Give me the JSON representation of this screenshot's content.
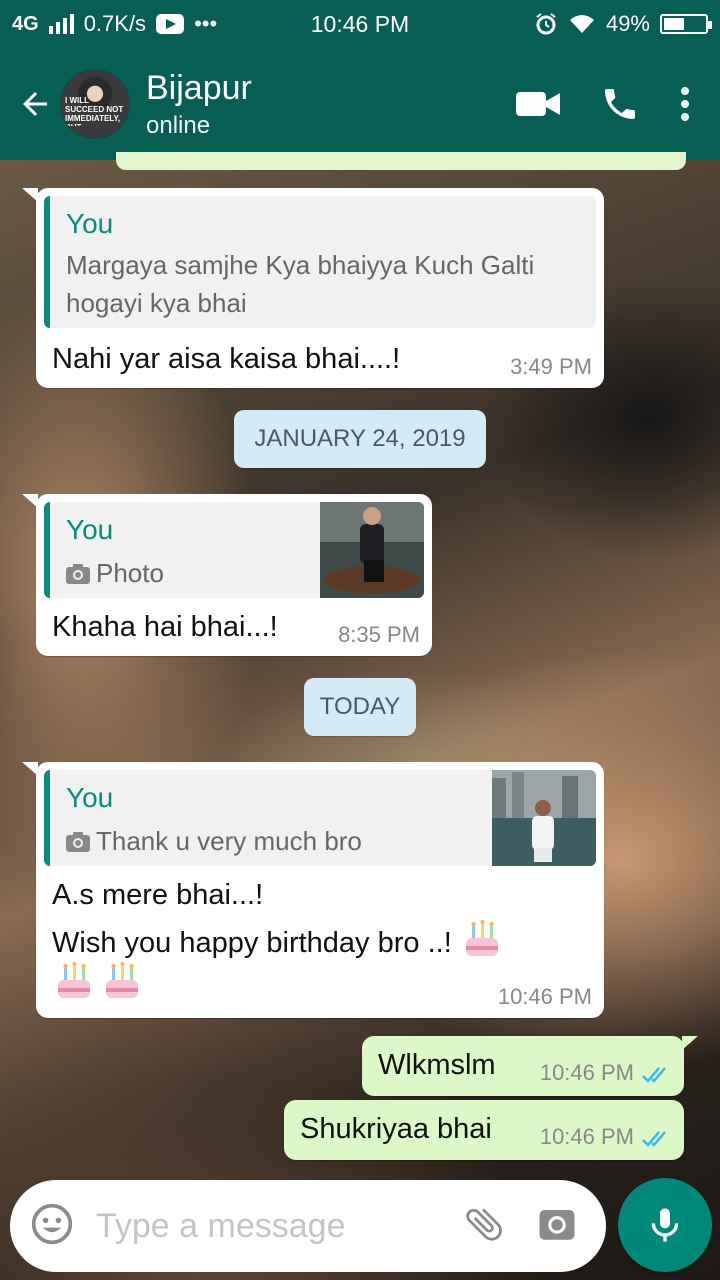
{
  "status_bar": {
    "network": "4G",
    "speed": "0.7K/s",
    "more": "•••",
    "time": "10:46 PM",
    "battery": "49%",
    "battery_level": 0.49
  },
  "header": {
    "contact_name": "Bijapur",
    "contact_status": "online",
    "avatar_text": "I WILL SUCCEED NOT IMMEDIATELY, BUT DEFINITELY"
  },
  "messages": [
    {
      "type": "incoming",
      "quote_author": "You",
      "quote_text_line1": "Margaya samjhe Kya bhaiyya Kuch Galti",
      "quote_text_line2": "hogayi kya bhai",
      "text": "Nahi yar aisa kaisa bhai....!",
      "time": "3:49 PM"
    },
    {
      "type": "date",
      "label": "JANUARY 24, 2019"
    },
    {
      "type": "incoming",
      "quote_author": "You",
      "quote_text": "Photo",
      "text": "Khaha hai bhai...!",
      "time": "8:35 PM"
    },
    {
      "type": "date",
      "label": "TODAY"
    },
    {
      "type": "incoming",
      "quote_author": "You",
      "quote_text": "Thank u very much bro",
      "line1": "A.s mere bhai...!",
      "line2": "Wish you happy birthday bro ..!",
      "time": "10:46 PM"
    },
    {
      "type": "outgoing",
      "text": "Wlkmslm",
      "time": "10:46 PM"
    },
    {
      "type": "outgoing",
      "text": "Shukriyaa bhai",
      "time": "10:46 PM"
    }
  ],
  "composer": {
    "placeholder": "Type a message"
  },
  "colors": {
    "header": "#075e54",
    "accent": "#078c7e",
    "outgoing_bubble": "#dcf8c6",
    "read_ticks": "#34b7f1",
    "date_chip": "#d3eaf7",
    "mic_button": "#00897b"
  },
  "icons": {
    "back": "arrow-left-icon",
    "video": "video-camera-icon",
    "call": "phone-icon",
    "menu": "more-vertical-icon",
    "emoji": "emoji-icon",
    "attach": "paperclip-icon",
    "camera": "camera-icon",
    "mic": "microphone-icon",
    "photo": "camera-small-icon",
    "cake": "birthday-cake-emoji"
  }
}
